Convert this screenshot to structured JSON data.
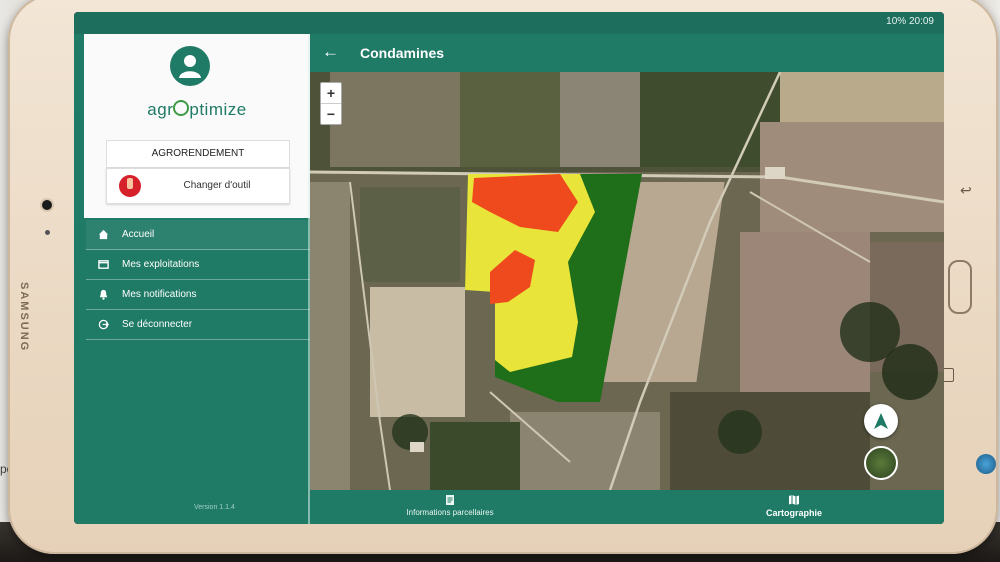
{
  "background": {
    "laptop_snippet": "pour re"
  },
  "device": {
    "brand": "SAMSUNG"
  },
  "statusbar": {
    "right": "10% 20:09"
  },
  "appbar": {
    "title": "Condamines",
    "back_icon": "arrow-left-icon"
  },
  "drawer": {
    "avatar_icon": "user-avatar-icon",
    "logo": {
      "part1": "agr",
      "part2": "ptimize"
    },
    "tool_name": "AGRORENDEMENT",
    "change_tool_label": "Changer d'outil",
    "menu": [
      {
        "label": "Accueil",
        "icon": "home-icon"
      },
      {
        "label": "Mes exploitations",
        "icon": "folder-icon"
      },
      {
        "label": "Mes notifications",
        "icon": "bell-icon"
      },
      {
        "label": "Se déconnecter",
        "icon": "logout-icon"
      }
    ],
    "version": "Version 1.1.4"
  },
  "map": {
    "zoom_in": "+",
    "zoom_out": "−",
    "yield_zone_colors": {
      "high": "#1f6e1a",
      "medium": "#e8e43a",
      "low": "#ef4a1e"
    }
  },
  "bottomnav": {
    "items": [
      {
        "label": "Informations parcellaires",
        "icon": "document-icon",
        "active": false
      },
      {
        "label": "Cartographie",
        "icon": "map-icon",
        "active": true
      }
    ]
  },
  "colors": {
    "primary": "#1f7a66"
  }
}
